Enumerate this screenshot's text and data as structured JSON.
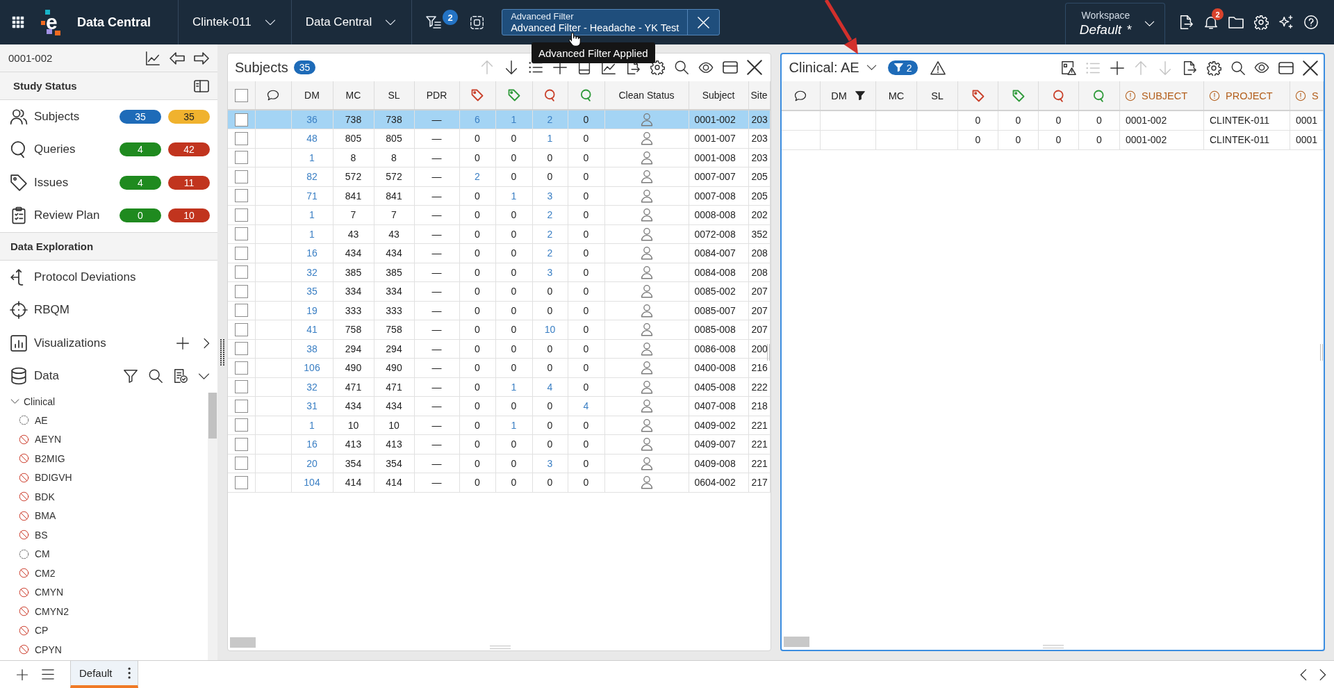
{
  "top_bar": {
    "logo_letter": "e",
    "app_name": "Data Central",
    "dropdowns": [
      {
        "label": "Clintek-011"
      },
      {
        "label": "Data Central"
      }
    ],
    "filter_count": "2",
    "filter_chip": {
      "caption": "Advanced Filter",
      "value": "Advanced Filter - Headache - YK Test"
    },
    "tooltip": "Advanced Filter Applied",
    "workspace": {
      "caption": "Workspace",
      "value": "Default",
      "marker": "*"
    },
    "notification_count": "2"
  },
  "sidebar": {
    "current_subject": "0001-002",
    "study_status": {
      "title": "Study Status",
      "items": [
        {
          "kind": "subjects",
          "label": "Subjects",
          "badges": [
            {
              "text": "35",
              "color": "#1e6bb8"
            },
            {
              "text": "35",
              "color": "#f0b22e"
            }
          ]
        },
        {
          "kind": "queries",
          "label": "Queries",
          "badges": [
            {
              "text": "4",
              "color": "#1f8a1f"
            },
            {
              "text": "42",
              "color": "#c1341e"
            }
          ]
        },
        {
          "kind": "issues",
          "label": "Issues",
          "badges": [
            {
              "text": "4",
              "color": "#1f8a1f"
            },
            {
              "text": "11",
              "color": "#c1341e"
            }
          ]
        },
        {
          "kind": "review",
          "label": "Review Plan",
          "badges": [
            {
              "text": "0",
              "color": "#1f8a1f"
            },
            {
              "text": "10",
              "color": "#c1341e"
            }
          ]
        }
      ]
    },
    "data_exploration": {
      "title": "Data Exploration",
      "items": [
        {
          "kind": "deviations",
          "label": "Protocol Deviations"
        },
        {
          "kind": "rbqm",
          "label": "RBQM"
        },
        {
          "kind": "visualizations",
          "label": "Visualizations"
        },
        {
          "kind": "data",
          "label": "Data"
        }
      ]
    },
    "tree": [
      {
        "label": "Clinical",
        "expanded": true,
        "children": [
          {
            "label": "AE",
            "kind": "pending"
          },
          {
            "label": "AEYN",
            "kind": "blocked"
          },
          {
            "label": "B2MIG",
            "kind": "blocked"
          },
          {
            "label": "BDIGVH",
            "kind": "blocked"
          },
          {
            "label": "BDK",
            "kind": "blocked"
          },
          {
            "label": "BMA",
            "kind": "blocked"
          },
          {
            "label": "BS",
            "kind": "blocked"
          },
          {
            "label": "CM",
            "kind": "pending"
          },
          {
            "label": "CM2",
            "kind": "blocked"
          },
          {
            "label": "CMYN",
            "kind": "blocked"
          },
          {
            "label": "CMYN2",
            "kind": "blocked"
          },
          {
            "label": "CP",
            "kind": "blocked"
          },
          {
            "label": "CPYN",
            "kind": "blocked"
          }
        ]
      }
    ]
  },
  "panels": [
    {
      "kind": "subjects",
      "title": "Subjects",
      "count": "35",
      "selected": false,
      "toolbar": [
        {
          "kind": "up",
          "disabled": true
        },
        {
          "kind": "down",
          "disabled": false
        },
        {
          "kind": "list",
          "disabled": false
        },
        {
          "kind": "add",
          "disabled": false
        },
        {
          "kind": "document",
          "disabled": false
        },
        {
          "kind": "chart",
          "disabled": false
        },
        {
          "kind": "export",
          "disabled": false
        },
        {
          "kind": "settings",
          "disabled": false
        },
        {
          "kind": "search",
          "disabled": false
        },
        {
          "kind": "view",
          "disabled": false
        },
        {
          "kind": "layout",
          "disabled": false
        },
        {
          "kind": "close",
          "disabled": false
        }
      ],
      "table": {
        "columns": [
          {
            "kind": "select",
            "checked": false
          },
          {
            "kind": "comments"
          },
          {
            "kind": "link",
            "label": "DM"
          },
          {
            "kind": "text",
            "label": "MC"
          },
          {
            "kind": "text",
            "label": "SL"
          },
          {
            "kind": "text",
            "label": "PDR"
          },
          {
            "kind": "issues",
            "color": "#c9412b"
          },
          {
            "kind": "issues",
            "color": "#2f9a3a"
          },
          {
            "kind": "queries",
            "color": "#c9412b"
          },
          {
            "kind": "queries",
            "color": "#2f9a3a"
          },
          {
            "kind": "status",
            "label": "Clean Status"
          },
          {
            "kind": "text",
            "label": "Subject"
          },
          {
            "kind": "text",
            "label": "Site"
          }
        ],
        "rows": [
          {
            "selected": true,
            "checked": false,
            "values": [
              "36",
              "738",
              "738",
              "—"
            ],
            "counts": [
              {
                "value": "6",
                "link": true
              },
              {
                "value": "1",
                "link": true
              },
              {
                "value": "2",
                "link": true
              },
              {
                "value": "0",
                "link": false
              }
            ],
            "subject": "0001-002",
            "site": "203"
          },
          {
            "selected": false,
            "checked": false,
            "values": [
              "48",
              "805",
              "805",
              "—"
            ],
            "counts": [
              {
                "value": "0",
                "link": false
              },
              {
                "value": "0",
                "link": false
              },
              {
                "value": "1",
                "link": true
              },
              {
                "value": "0",
                "link": false
              }
            ],
            "subject": "0001-007",
            "site": "203"
          },
          {
            "selected": false,
            "checked": false,
            "values": [
              "1",
              "8",
              "8",
              "—"
            ],
            "counts": [
              {
                "value": "0",
                "link": false
              },
              {
                "value": "0",
                "link": false
              },
              {
                "value": "0",
                "link": false
              },
              {
                "value": "0",
                "link": false
              }
            ],
            "subject": "0001-008",
            "site": "203"
          },
          {
            "selected": false,
            "checked": false,
            "values": [
              "82",
              "572",
              "572",
              "—"
            ],
            "counts": [
              {
                "value": "2",
                "link": true
              },
              {
                "value": "0",
                "link": false
              },
              {
                "value": "0",
                "link": false
              },
              {
                "value": "0",
                "link": false
              }
            ],
            "subject": "0007-007",
            "site": "205"
          },
          {
            "selected": false,
            "checked": false,
            "values": [
              "71",
              "841",
              "841",
              "—"
            ],
            "counts": [
              {
                "value": "0",
                "link": false
              },
              {
                "value": "1",
                "link": true
              },
              {
                "value": "3",
                "link": true
              },
              {
                "value": "0",
                "link": false
              }
            ],
            "subject": "0007-008",
            "site": "205"
          },
          {
            "selected": false,
            "checked": false,
            "values": [
              "1",
              "7",
              "7",
              "—"
            ],
            "counts": [
              {
                "value": "0",
                "link": false
              },
              {
                "value": "0",
                "link": false
              },
              {
                "value": "2",
                "link": true
              },
              {
                "value": "0",
                "link": false
              }
            ],
            "subject": "0008-008",
            "site": "202"
          },
          {
            "selected": false,
            "checked": false,
            "values": [
              "1",
              "43",
              "43",
              "—"
            ],
            "counts": [
              {
                "value": "0",
                "link": false
              },
              {
                "value": "0",
                "link": false
              },
              {
                "value": "2",
                "link": true
              },
              {
                "value": "0",
                "link": false
              }
            ],
            "subject": "0072-008",
            "site": "352"
          },
          {
            "selected": false,
            "checked": false,
            "values": [
              "16",
              "434",
              "434",
              "—"
            ],
            "counts": [
              {
                "value": "0",
                "link": false
              },
              {
                "value": "0",
                "link": false
              },
              {
                "value": "2",
                "link": true
              },
              {
                "value": "0",
                "link": false
              }
            ],
            "subject": "0084-007",
            "site": "208"
          },
          {
            "selected": false,
            "checked": false,
            "values": [
              "32",
              "385",
              "385",
              "—"
            ],
            "counts": [
              {
                "value": "0",
                "link": false
              },
              {
                "value": "0",
                "link": false
              },
              {
                "value": "3",
                "link": true
              },
              {
                "value": "0",
                "link": false
              }
            ],
            "subject": "0084-008",
            "site": "208"
          },
          {
            "selected": false,
            "checked": false,
            "values": [
              "35",
              "334",
              "334",
              "—"
            ],
            "counts": [
              {
                "value": "0",
                "link": false
              },
              {
                "value": "0",
                "link": false
              },
              {
                "value": "0",
                "link": false
              },
              {
                "value": "0",
                "link": false
              }
            ],
            "subject": "0085-002",
            "site": "207"
          },
          {
            "selected": false,
            "checked": false,
            "values": [
              "19",
              "333",
              "333",
              "—"
            ],
            "counts": [
              {
                "value": "0",
                "link": false
              },
              {
                "value": "0",
                "link": false
              },
              {
                "value": "0",
                "link": false
              },
              {
                "value": "0",
                "link": false
              }
            ],
            "subject": "0085-007",
            "site": "207"
          },
          {
            "selected": false,
            "checked": false,
            "values": [
              "41",
              "758",
              "758",
              "—"
            ],
            "counts": [
              {
                "value": "0",
                "link": false
              },
              {
                "value": "0",
                "link": false
              },
              {
                "value": "10",
                "link": true
              },
              {
                "value": "0",
                "link": false
              }
            ],
            "subject": "0085-008",
            "site": "207"
          },
          {
            "selected": false,
            "checked": false,
            "values": [
              "38",
              "294",
              "294",
              "—"
            ],
            "counts": [
              {
                "value": "0",
                "link": false
              },
              {
                "value": "0",
                "link": false
              },
              {
                "value": "0",
                "link": false
              },
              {
                "value": "0",
                "link": false
              }
            ],
            "subject": "0086-008",
            "site": "200"
          },
          {
            "selected": false,
            "checked": false,
            "values": [
              "106",
              "490",
              "490",
              "—"
            ],
            "counts": [
              {
                "value": "0",
                "link": false
              },
              {
                "value": "0",
                "link": false
              },
              {
                "value": "0",
                "link": false
              },
              {
                "value": "0",
                "link": false
              }
            ],
            "subject": "0400-008",
            "site": "216"
          },
          {
            "selected": false,
            "checked": false,
            "values": [
              "32",
              "471",
              "471",
              "—"
            ],
            "counts": [
              {
                "value": "0",
                "link": false
              },
              {
                "value": "1",
                "link": true
              },
              {
                "value": "4",
                "link": true
              },
              {
                "value": "0",
                "link": false
              }
            ],
            "subject": "0405-008",
            "site": "222"
          },
          {
            "selected": false,
            "checked": false,
            "values": [
              "31",
              "434",
              "434",
              "—"
            ],
            "counts": [
              {
                "value": "0",
                "link": false
              },
              {
                "value": "0",
                "link": false
              },
              {
                "value": "0",
                "link": false
              },
              {
                "value": "4",
                "link": true
              }
            ],
            "subject": "0407-008",
            "site": "218"
          },
          {
            "selected": false,
            "checked": false,
            "values": [
              "1",
              "10",
              "10",
              "—"
            ],
            "counts": [
              {
                "value": "0",
                "link": false
              },
              {
                "value": "1",
                "link": true
              },
              {
                "value": "0",
                "link": false
              },
              {
                "value": "0",
                "link": false
              }
            ],
            "subject": "0409-002",
            "site": "221"
          },
          {
            "selected": false,
            "checked": false,
            "values": [
              "16",
              "413",
              "413",
              "—"
            ],
            "counts": [
              {
                "value": "0",
                "link": false
              },
              {
                "value": "0",
                "link": false
              },
              {
                "value": "0",
                "link": false
              },
              {
                "value": "0",
                "link": false
              }
            ],
            "subject": "0409-007",
            "site": "221"
          },
          {
            "selected": false,
            "checked": false,
            "values": [
              "20",
              "354",
              "354",
              "—"
            ],
            "counts": [
              {
                "value": "0",
                "link": false
              },
              {
                "value": "0",
                "link": false
              },
              {
                "value": "3",
                "link": true
              },
              {
                "value": "0",
                "link": false
              }
            ],
            "subject": "0409-008",
            "site": "221"
          },
          {
            "selected": false,
            "checked": false,
            "values": [
              "104",
              "414",
              "414",
              "—"
            ],
            "counts": [
              {
                "value": "0",
                "link": false
              },
              {
                "value": "0",
                "link": false
              },
              {
                "value": "0",
                "link": false
              },
              {
                "value": "0",
                "link": false
              }
            ],
            "subject": "0604-002",
            "site": "217"
          }
        ]
      }
    },
    {
      "kind": "dataset",
      "title": "Clinical: AE",
      "filter_count": "2",
      "selected": true,
      "toolbar": [
        {
          "kind": "image-warning",
          "disabled": false
        },
        {
          "kind": "list",
          "disabled": true
        },
        {
          "kind": "add",
          "disabled": false
        },
        {
          "kind": "up",
          "disabled": true
        },
        {
          "kind": "down",
          "disabled": true
        },
        {
          "kind": "export",
          "disabled": false
        },
        {
          "kind": "settings",
          "disabled": false
        },
        {
          "kind": "search",
          "disabled": false
        },
        {
          "kind": "view",
          "disabled": false
        },
        {
          "kind": "layout",
          "disabled": false
        },
        {
          "kind": "close",
          "disabled": false
        }
      ],
      "table": {
        "columns": [
          {
            "kind": "comments"
          },
          {
            "kind": "text",
            "label": "DM",
            "filtered": true
          },
          {
            "kind": "text",
            "label": "MC",
            "filtered": false
          },
          {
            "kind": "text",
            "label": "SL",
            "filtered": false
          },
          {
            "kind": "issues",
            "color": "#c9412b"
          },
          {
            "kind": "issues",
            "color": "#2f9a3a"
          },
          {
            "kind": "queries",
            "color": "#c9412b"
          },
          {
            "kind": "queries",
            "color": "#2f9a3a"
          },
          {
            "kind": "flagged",
            "label": "SUBJECT"
          },
          {
            "kind": "flagged",
            "label": "PROJECT"
          },
          {
            "kind": "flagged",
            "label": "S"
          }
        ],
        "rows": [
          {
            "counts": [
              "0",
              "0",
              "0",
              "0"
            ],
            "subject": "0001-002",
            "project": "CLINTEK-011",
            "column_11": "0001"
          },
          {
            "counts": [
              "0",
              "0",
              "0",
              "0"
            ],
            "subject": "0001-002",
            "project": "CLINTEK-011",
            "column_11": "0001"
          }
        ]
      }
    }
  ],
  "bottom_bar": {
    "tabs": [
      {
        "label": "Default",
        "selected": true
      }
    ]
  }
}
